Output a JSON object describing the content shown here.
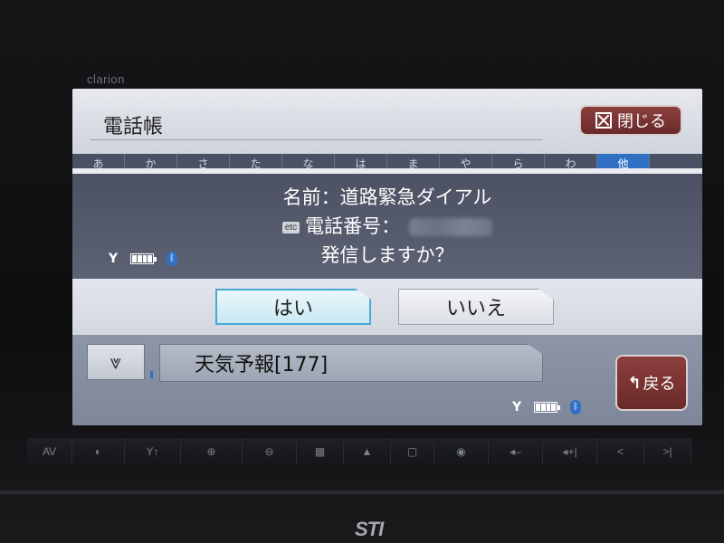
{
  "device": {
    "brand": "clarion",
    "logo_text": "STI"
  },
  "header": {
    "title": "電話帳",
    "close_label": "閉じる"
  },
  "kana_index": [
    {
      "label": "あ",
      "selected": false
    },
    {
      "label": "か",
      "selected": false
    },
    {
      "label": "さ",
      "selected": false
    },
    {
      "label": "た",
      "selected": false
    },
    {
      "label": "な",
      "selected": false
    },
    {
      "label": "は",
      "selected": false
    },
    {
      "label": "ま",
      "selected": false
    },
    {
      "label": "や",
      "selected": false
    },
    {
      "label": "ら",
      "selected": false
    },
    {
      "label": "わ",
      "selected": false
    },
    {
      "label": "他",
      "selected": true
    }
  ],
  "dialog": {
    "name_line": "名前：道路緊急ダイアル",
    "etc_badge": "etc",
    "phone_label": "電話番号：",
    "question": "発信しますか？",
    "yes_label": "はい",
    "no_label": "いいえ"
  },
  "list": {
    "scroll_icon": "double-chevron-down-icon",
    "current_item": "天気予報[177]"
  },
  "back_button": {
    "label": "戻る"
  },
  "hardware_buttons": [
    "AV",
    "◐",
    "Y↑",
    "⊕",
    "⊖",
    "▦",
    "▲",
    "▢",
    "◉",
    "◂–",
    "◂+|",
    "<",
    ">|"
  ],
  "colors": {
    "accent_red": "#7a3331",
    "highlight_blue": "#2f70c4",
    "yes_border": "#48a9d6"
  }
}
